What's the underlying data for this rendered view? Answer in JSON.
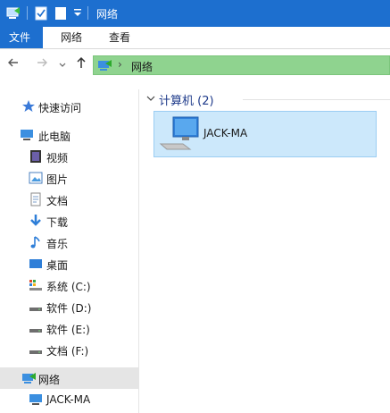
{
  "window": {
    "title": "网络"
  },
  "ribbon": {
    "tabs": [
      {
        "label": "文件"
      },
      {
        "label": "网络"
      },
      {
        "label": "查看"
      }
    ]
  },
  "address": {
    "crumb": "网络"
  },
  "sidebar": {
    "items": [
      {
        "label": "快速访问",
        "icon": "star-pin-icon"
      },
      {
        "label": "此电脑",
        "icon": "computer-icon"
      },
      {
        "label": "视频",
        "icon": "video-icon"
      },
      {
        "label": "图片",
        "icon": "picture-icon"
      },
      {
        "label": "文档",
        "icon": "document-icon"
      },
      {
        "label": "下载",
        "icon": "download-icon"
      },
      {
        "label": "音乐",
        "icon": "music-icon"
      },
      {
        "label": "桌面",
        "icon": "desktop-icon"
      },
      {
        "label": "系统 (C:)",
        "icon": "system-drive-icon"
      },
      {
        "label": "软件 (D:)",
        "icon": "drive-icon"
      },
      {
        "label": "软件 (E:)",
        "icon": "drive-icon"
      },
      {
        "label": "文档 (F:)",
        "icon": "drive-icon"
      },
      {
        "label": "网络",
        "icon": "network-icon"
      },
      {
        "label": "JACK-MA",
        "icon": "computer-icon"
      }
    ]
  },
  "content": {
    "group_header": "计算机 (2)",
    "items": [
      {
        "name": "JACK-MA",
        "icon": "computer-icon"
      }
    ]
  },
  "colors": {
    "titlebar": "#1d6fcf",
    "address_bar": "#8fd38f",
    "selection": "#cce8fb"
  }
}
